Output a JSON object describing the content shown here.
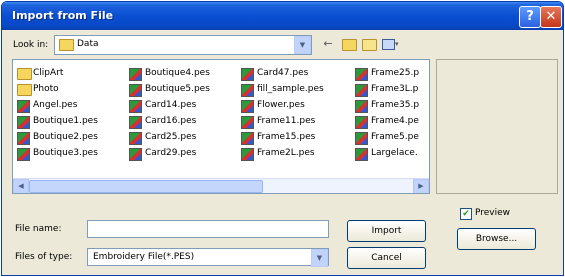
{
  "window": {
    "title": "Import from File",
    "help_label": "?",
    "close_label": "✕"
  },
  "lookin": {
    "label": "Look in:",
    "value": "Data"
  },
  "toolbar": {
    "back_icon": "back-arrow-icon",
    "up_icon": "up-folder-icon",
    "new_icon": "new-folder-icon",
    "view_icon": "view-menu-icon"
  },
  "files": {
    "columns": [
      [
        {
          "name": "ClipArt",
          "type": "folder"
        },
        {
          "name": "Photo",
          "type": "folder"
        },
        {
          "name": "Angel.pes",
          "type": "file"
        },
        {
          "name": "Boutique1.pes",
          "type": "file"
        },
        {
          "name": "Boutique2.pes",
          "type": "file"
        },
        {
          "name": "Boutique3.pes",
          "type": "file"
        }
      ],
      [
        {
          "name": "Boutique4.pes",
          "type": "file"
        },
        {
          "name": "Boutique5.pes",
          "type": "file"
        },
        {
          "name": "Card14.pes",
          "type": "file"
        },
        {
          "name": "Card16.pes",
          "type": "file"
        },
        {
          "name": "Card25.pes",
          "type": "file"
        },
        {
          "name": "Card29.pes",
          "type": "file"
        }
      ],
      [
        {
          "name": "Card47.pes",
          "type": "file"
        },
        {
          "name": "fill_sample.pes",
          "type": "file"
        },
        {
          "name": "Flower.pes",
          "type": "file"
        },
        {
          "name": "Frame11.pes",
          "type": "file"
        },
        {
          "name": "Frame15.pes",
          "type": "file"
        },
        {
          "name": "Frame2L.pes",
          "type": "file"
        }
      ],
      [
        {
          "name": "Frame25.p",
          "type": "file"
        },
        {
          "name": "Frame3L.p",
          "type": "file"
        },
        {
          "name": "Frame35.p",
          "type": "file"
        },
        {
          "name": "Frame4.pe",
          "type": "file"
        },
        {
          "name": "Frame5.pe",
          "type": "file"
        },
        {
          "name": "Largelace.",
          "type": "file"
        }
      ]
    ]
  },
  "form": {
    "file_name_label": "File name:",
    "file_name_value": "",
    "files_of_type_label": "Files of type:",
    "files_of_type_value": "Embroidery File(*.PES)"
  },
  "buttons": {
    "import": "Import",
    "cancel": "Cancel",
    "browse": "Browse..."
  },
  "preview": {
    "label": "Preview",
    "checked": true,
    "check_mark": "✔"
  },
  "scroll": {
    "left": "◀",
    "right": "▶",
    "drop": "▼"
  }
}
